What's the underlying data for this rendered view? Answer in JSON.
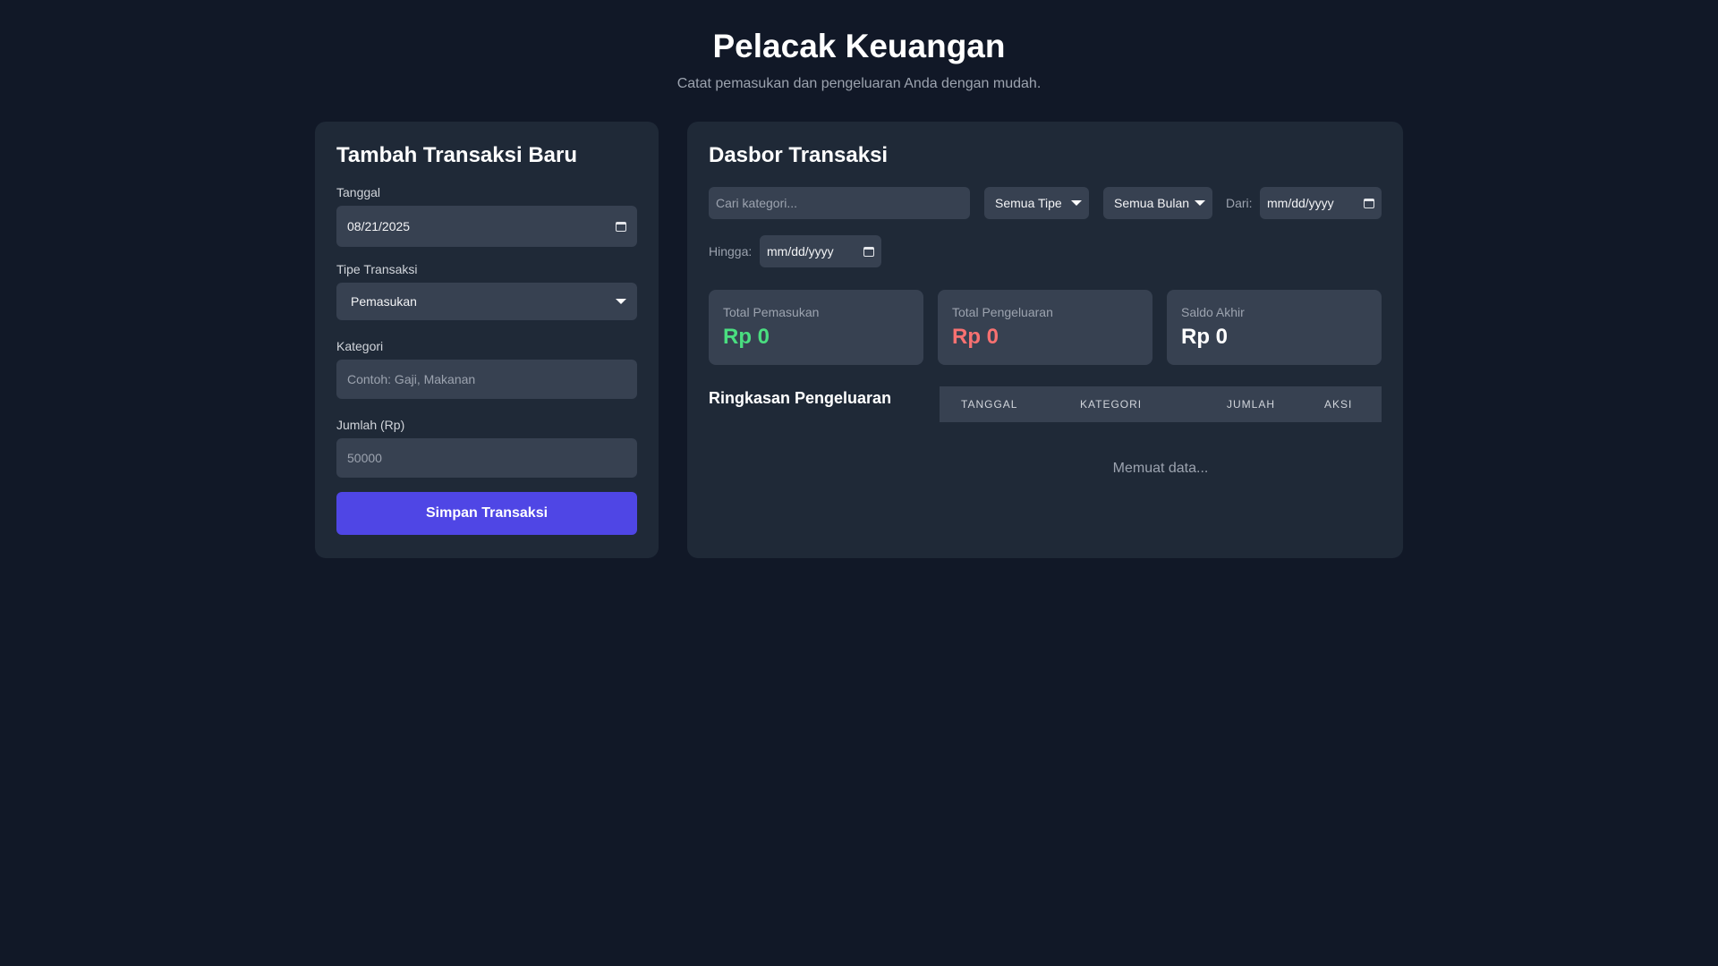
{
  "header": {
    "title": "Pelacak Keuangan",
    "subtitle": "Catat pemasukan dan pengeluaran Anda dengan mudah."
  },
  "form": {
    "title": "Tambah Transaksi Baru",
    "date_label": "Tanggal",
    "date_value": "08/21/2025",
    "type_label": "Tipe Transaksi",
    "type_value": "Pemasukan",
    "category_label": "Kategori",
    "category_placeholder": "Contoh: Gaji, Makanan",
    "amount_label": "Jumlah (Rp)",
    "amount_placeholder": "50000",
    "submit_label": "Simpan Transaksi"
  },
  "dashboard": {
    "title": "Dasbor Transaksi",
    "filters": {
      "search_placeholder": "Cari kategori...",
      "type_value": "Semua Tipe",
      "month_value": "Semua Bulan",
      "from_label": "Dari:",
      "from_placeholder": "mm/dd/yyyy",
      "to_label": "Hingga:",
      "to_placeholder": "mm/dd/yyyy"
    },
    "stats": {
      "income_label": "Total Pemasukan",
      "income_value": "Rp 0",
      "expense_label": "Total Pengeluaran",
      "expense_value": "Rp 0",
      "balance_label": "Saldo Akhir",
      "balance_value": "Rp 0"
    },
    "summary_title": "Ringkasan Pengeluaran",
    "table": {
      "headers": [
        "TANGGAL",
        "KATEGORI",
        "JUMLAH",
        "AKSI"
      ],
      "loading_text": "Memuat data..."
    }
  },
  "colors": {
    "background": "#111827",
    "card": "#1f2937",
    "input": "#374151",
    "accent": "#4f46e5",
    "income": "#4ade80",
    "expense": "#f87171"
  }
}
